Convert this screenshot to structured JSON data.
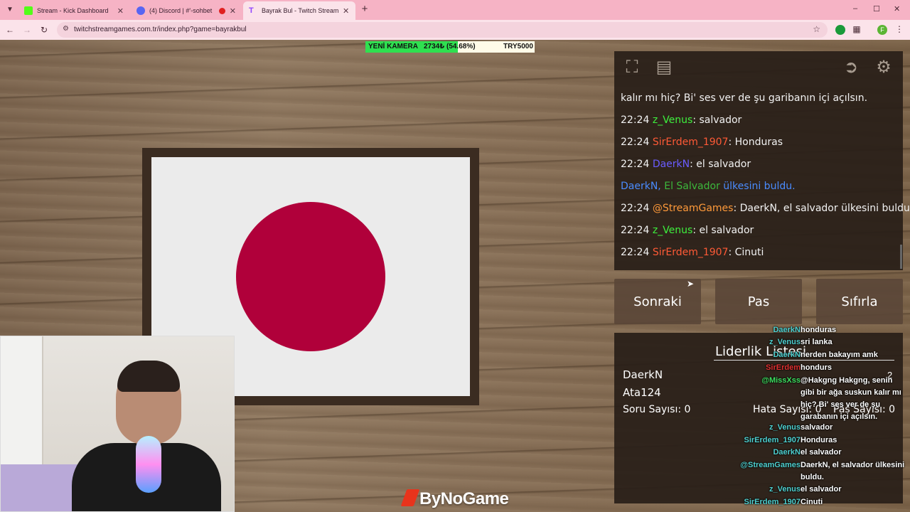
{
  "browser": {
    "tabs": [
      {
        "label": "Stream - Kick Dashboard",
        "favicon_color": "#53fc18"
      },
      {
        "label": "(4) Discord | #'◦sohbet",
        "favicon_color": "#5865f2"
      },
      {
        "label": "Bayrak Bul - Twitch Stream Gam",
        "favicon_color": "#9146ff"
      }
    ],
    "new_tab": "+",
    "url": "twitchstreamgames.com.tr/index.php?game=bayrakbul",
    "window_controls": [
      "–",
      "☐",
      "✕"
    ],
    "profile_letter": "F",
    "profile_color": "#5bb534",
    "extension_color": "#1a9a3a"
  },
  "goal_bar": {
    "label": "YENİ KAMERA",
    "amount": "2734₺ (54.68%)",
    "target": "TRY5000",
    "progress": 0.5468,
    "fill_color": "#2fe050"
  },
  "flag": {
    "background": "#ebebeb",
    "disc_color": "#b0003a"
  },
  "brand": "ByNoGame",
  "panel": {
    "icons": [
      "fullscreen-icon",
      "document-icon",
      "exit-icon",
      "gear-icon"
    ],
    "chat": [
      {
        "time": "",
        "user": "",
        "user_color": "",
        "text": "kalır mı hiç? Bi' ses ver de şu garibanın içi açılsın."
      },
      {
        "time": "22:24",
        "user": "z_Venus",
        "user_color": "#3df03d",
        "text": ": salvador"
      },
      {
        "time": "22:24",
        "user": "SirErdem_1907",
        "user_color": "#ff5a36",
        "text": ": Honduras"
      },
      {
        "time": "22:24",
        "user": "DaerkN",
        "user_color": "#6a5cff",
        "text": ": el salvador"
      },
      {
        "time": "",
        "user": "DaerkN,",
        "user_color": "#4a8cff",
        "text": "",
        "extra": "El Salvador",
        "extra_color": "#3cb83c",
        "tail": "ülkesini buldu.",
        "tail_color": "#4a8cff"
      },
      {
        "time": "22:24",
        "user": "@StreamGames",
        "user_color": "#ff9a3a",
        "text": ": DaerkN, el salvador ülkesini buldu."
      },
      {
        "time": "22:24",
        "user": "z_Venus",
        "user_color": "#3df03d",
        "text": ": el salvador"
      },
      {
        "time": "22:24",
        "user": "SirErdem_1907",
        "user_color": "#ff5a36",
        "text": ": Cinuti"
      }
    ],
    "buttons": {
      "next": "Sonraki",
      "pass": "Pas",
      "reset": "Sıfırla"
    }
  },
  "leaderboard": {
    "title": "Liderlik Listesi",
    "players": [
      {
        "name": "DaerkN",
        "score": "2"
      },
      {
        "name": "Ata124",
        "score": ""
      }
    ],
    "stats": {
      "questions": "Soru Sayısı: 0",
      "errors": "Hata Sayısı: 0",
      "passes": "Pas Sayısı: 0"
    }
  },
  "obs_chat": [
    {
      "user": "DaerkN",
      "user_color": "#4fd0d0",
      "text": "honduras"
    },
    {
      "user": "z_Venus",
      "user_color": "#4fd0d0",
      "text": "sri lanka"
    },
    {
      "user": "DaerkN",
      "user_color": "#4fd0d0",
      "text": "nerden bakayım amk"
    },
    {
      "user": "SirErdem",
      "user_color": "#e03030",
      "text": "hondurs"
    },
    {
      "user": "@MissXss",
      "user_color": "#3ee060",
      "text": "@Hakgng Hakgng, senin gibi bir ağa suskun kalır mı hiç? Bi' ses ver de şu garabanın içi açılsın."
    },
    {
      "user": "z_Venus",
      "user_color": "#4fd0d0",
      "text": "salvador"
    },
    {
      "user": "SirErdem_1907",
      "user_color": "#4fd0d0",
      "text": "Honduras"
    },
    {
      "user": "DaerkN",
      "user_color": "#4fd0d0",
      "text": "el salvador"
    },
    {
      "user": "@StreamGames",
      "user_color": "#4fd0d0",
      "text": "DaerkN, el salvador ülkesini buldu."
    },
    {
      "user": "z_Venus",
      "user_color": "#4fd0d0",
      "text": "el salvador"
    },
    {
      "user": "SirErdem_1907",
      "user_color": "#4fd0d0",
      "text": "Cinuti"
    }
  ]
}
